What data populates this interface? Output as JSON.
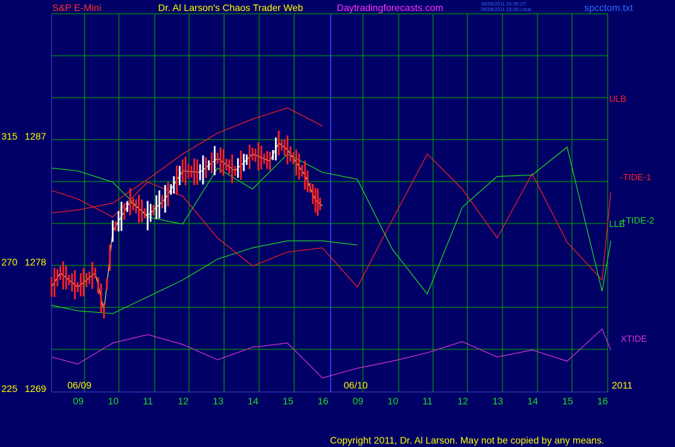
{
  "header": {
    "left": "S&P E-Mini",
    "center": "Dr. Al Larson's Chaos Trader Web",
    "site": "Daytradingforecasts.com",
    "stamp1": "06/09/2011 20:39 UT",
    "stamp2": "06/09/2011 15:39 Local",
    "file": "spcctom.txt"
  },
  "footer": {
    "copyright": "Copyright 2011, Dr. Al Larson. May not be copied by any means."
  },
  "colors": {
    "background": "#000066",
    "grid": "#00aa00",
    "frame": "#4444cc",
    "price_text": "#ffff00",
    "red": "#ff2222",
    "green": "#22dd22",
    "magenta": "#dd33dd",
    "white": "#ffffff",
    "blue": "#2255ff"
  },
  "chart_data": {
    "type": "line",
    "title": "S&P E-Mini",
    "y_labels": [
      {
        "code": "315",
        "price": "1287",
        "value": 1287
      },
      {
        "code": "270",
        "price": "1278",
        "value": 1278
      },
      {
        "code": "225",
        "price": "1269",
        "value": 1269
      }
    ],
    "ylim": [
      1269,
      1287
    ],
    "date_labels": [
      "06/09",
      "06/10",
      "2011"
    ],
    "x_ticks": [
      "09",
      "10",
      "11",
      "12",
      "13",
      "14",
      "15",
      "16",
      "09",
      "10",
      "11",
      "12",
      "13",
      "14",
      "15",
      "16"
    ],
    "hours": [
      8.25,
      9,
      10,
      11,
      12,
      13,
      14,
      15,
      16,
      17,
      18,
      19,
      20,
      21,
      22,
      23,
      24,
      24.25
    ],
    "series": [
      {
        "name": "ULB",
        "color": "#ff2222",
        "values": [
          1281.8,
          1282.0,
          1282.5,
          1284.2,
          1286.0,
          1287.5,
          1288.5,
          1289.3,
          1288.0,
          null,
          null,
          null,
          null,
          null,
          null,
          null,
          null,
          null
        ]
      },
      {
        "name": "LLB",
        "color": "#22dd22",
        "values": [
          1275.2,
          1274.8,
          1274.6,
          1275.8,
          1277.0,
          1278.5,
          1279.3,
          1279.8,
          1279.8,
          1279.5,
          null,
          null,
          null,
          null,
          null,
          null,
          null,
          null
        ]
      },
      {
        "name": "-TIDE-1",
        "color": "#ff2222",
        "values": [
          1283.4,
          1282.8,
          1281.5,
          1284.0,
          1283.0,
          1280.0,
          1278.0,
          1279.0,
          1279.3,
          1276.5,
          1281.3,
          1286.0,
          1283.5,
          1280.0,
          1284.6,
          1279.7,
          1277.0,
          1283.3
        ]
      },
      {
        "name": "+TIDE-2",
        "color": "#22dd22",
        "values": [
          1285.0,
          1284.8,
          1284.0,
          1281.5,
          1281.0,
          1285.0,
          1283.5,
          1286.0,
          1284.7,
          1284.2,
          1279.2,
          1276.0,
          1282.2,
          1284.4,
          1284.5,
          1286.5,
          1276.2,
          1279.8
        ]
      },
      {
        "name": "XTIDE",
        "color": "#dd33dd",
        "values": [
          1271.5,
          1271.0,
          1272.5,
          1273.1,
          1272.4,
          1271.3,
          1272.2,
          1272.5,
          1270.0,
          1270.7,
          1271.2,
          1271.8,
          1272.6,
          1271.5,
          1272.0,
          1271.2,
          1273.5,
          1272.0
        ]
      }
    ],
    "price_close": {
      "hours": [
        8.25,
        8.5,
        9,
        9.5,
        9.75,
        10,
        10.5,
        11,
        11.5,
        12,
        12.5,
        13,
        13.5,
        14,
        14.5,
        14.75,
        15,
        15.5,
        15.8,
        16
      ],
      "values": [
        1276.5,
        1277.5,
        1276.5,
        1277.5,
        1274.8,
        1280.5,
        1282.6,
        1281.6,
        1282.8,
        1284.8,
        1284.7,
        1285.7,
        1284.8,
        1286.0,
        1285.5,
        1286.8,
        1286.3,
        1284.5,
        1282.7,
        1282.3
      ]
    },
    "legend": [
      "ULB",
      "-TIDE-1",
      "LLB",
      "+TIDE-2",
      "XTIDE"
    ]
  }
}
